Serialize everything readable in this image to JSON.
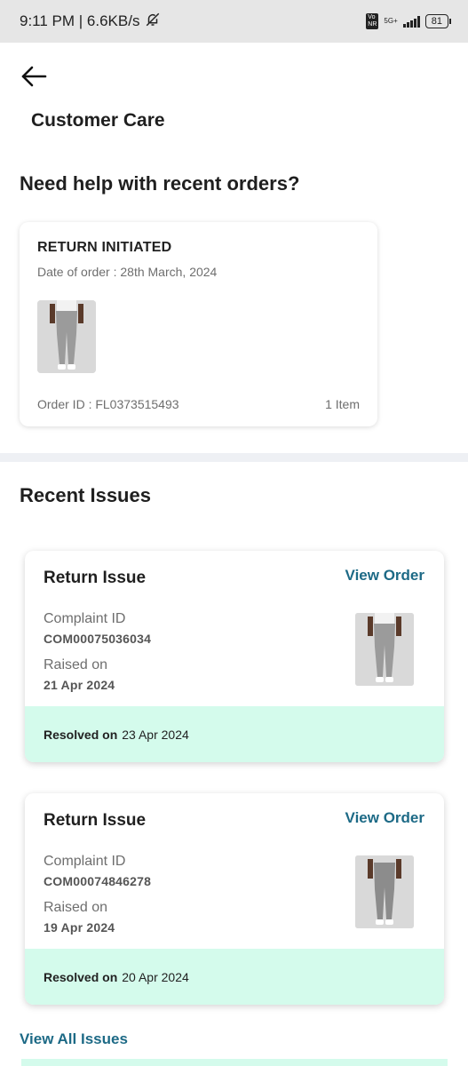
{
  "status_bar": {
    "time_speed": "9:11 PM | 6.6KB/s",
    "vo_label": "Vo\nNR",
    "network_label": "5G+",
    "battery": "81"
  },
  "page": {
    "title": "Customer Care",
    "help_heading": "Need help with recent orders?"
  },
  "recent_order": {
    "status": "RETURN INITIATED",
    "date": "Date of order : 28th March, 2024",
    "order_id": "Order ID : FL0373515493",
    "item_count": "1 Item"
  },
  "recent_issues": {
    "heading": "Recent Issues",
    "view_all_label": "View All Issues",
    "items": [
      {
        "title": "Return Issue",
        "view_order_label": "View Order",
        "complaint_label": "Complaint ID",
        "complaint_id": "COM00075036034",
        "raised_label": "Raised on",
        "raised_date": "21 Apr 2024",
        "resolved_label": "Resolved on",
        "resolved_date": "23 Apr 2024"
      },
      {
        "title": "Return Issue",
        "view_order_label": "View Order",
        "complaint_label": "Complaint ID",
        "complaint_id": "COM00074846278",
        "raised_label": "Raised on",
        "raised_date": "19 Apr 2024",
        "resolved_label": "Resolved on",
        "resolved_date": "20 Apr 2024"
      }
    ]
  },
  "colors": {
    "accent_link": "#1d6a86",
    "resolved_bg": "#d4fbec",
    "divider_band": "#eef0f4"
  },
  "icons": {
    "back": "arrow-left-icon",
    "mute": "bell-off-icon",
    "signal": "signal-bars-icon",
    "battery": "battery-icon"
  }
}
